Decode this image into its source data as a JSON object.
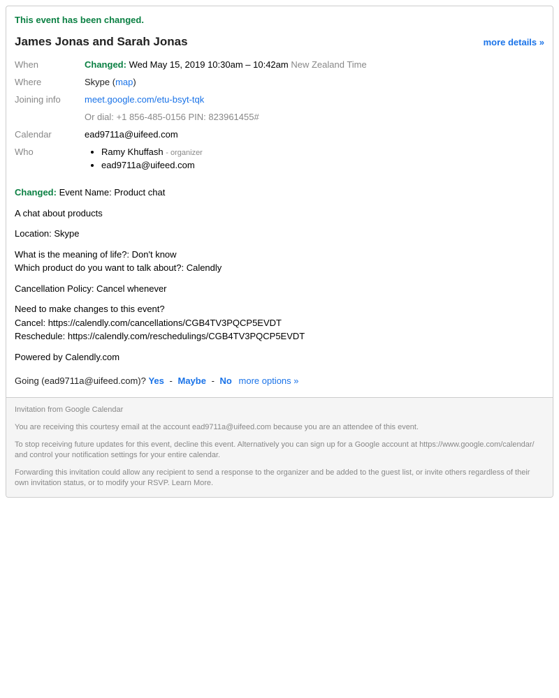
{
  "banner": "This event has been changed.",
  "title": "James Jonas and Sarah Jonas",
  "more_details": "more details »",
  "labels": {
    "when": "When",
    "where": "Where",
    "joining": "Joining info",
    "calendar": "Calendar",
    "who": "Who"
  },
  "when": {
    "changed": "Changed:",
    "datetime": "Wed May 15, 2019 10:30am – 10:42am",
    "tz": "New Zealand Time"
  },
  "where": {
    "prefix": "Skype (",
    "map": "map",
    "suffix": ")"
  },
  "joining": {
    "link": "meet.google.com/etu-bsyt-tqk",
    "dial": "Or dial: +1 856-485-0156  PIN: 823961455#"
  },
  "calendar": "ead9711a@uifeed.com",
  "who": {
    "attendee1": "Ramy Khuffash",
    "organizer_tag": "- organizer",
    "attendee2": "ead9711a@uifeed.com"
  },
  "desc": {
    "changed": "Changed:",
    "event_name": "Event Name: Product chat",
    "chat": "A chat about products",
    "location": "Location: Skype",
    "q1": "What is the meaning of life?: Don't know",
    "q2": "Which product do you want to talk about?: Calendly",
    "cancellation": "Cancellation Policy: Cancel whenever",
    "changes_q": "Need to make changes to this event?",
    "cancel": "Cancel: https://calendly.com/cancellations/CGB4TV3PQCP5EVDT",
    "reschedule": "Reschedule: https://calendly.com/reschedulings/CGB4TV3PQCP5EVDT",
    "powered": "Powered by Calendly.com"
  },
  "going": {
    "text": "Going (ead9711a@uifeed.com)?  ",
    "yes": "Yes",
    "maybe": "Maybe",
    "no": "No",
    "more": "more options »",
    "sep": "-"
  },
  "footer": {
    "l1": "Invitation from Google Calendar",
    "l2": "You are receiving this courtesy email at the account ead9711a@uifeed.com because you are an attendee of this event.",
    "l3": "To stop receiving future updates for this event, decline this event. Alternatively you can sign up for a Google account at https://www.google.com/calendar/ and control your notification settings for your entire calendar.",
    "l4": "Forwarding this invitation could allow any recipient to send a response to the organizer and be added to the guest list, or invite others regardless of their own invitation status, or to modify your RSVP. Learn More."
  }
}
